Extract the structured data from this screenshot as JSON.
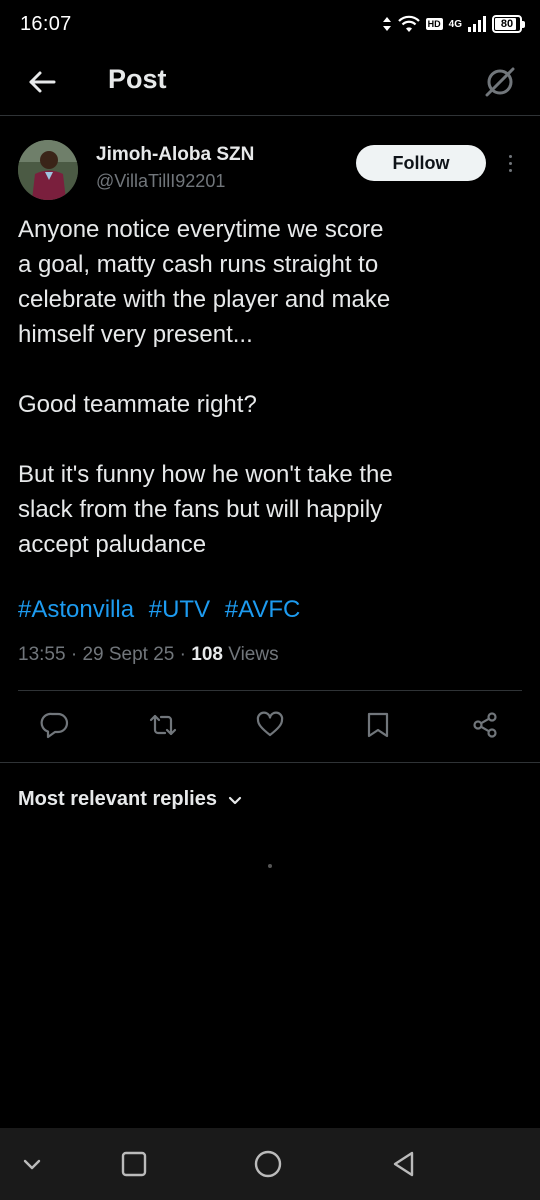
{
  "status_bar": {
    "time": "16:07",
    "network_badge": "HD",
    "network_type": "4G",
    "battery": "80",
    "battery_level": 0.8
  },
  "header": {
    "title": "Post",
    "back_icon": "arrow-left-icon",
    "grok_icon": "grok-icon"
  },
  "post": {
    "author_name": "Jimoh-Aloba SZN",
    "author_handle": "@VillaTillI92201",
    "follow_label": "Follow",
    "body_lines": [
      "Anyone notice everytime we score",
      "a goal, matty cash runs straight to",
      "celebrate with the player and make",
      "himself very present...",
      "",
      "Good teammate right?",
      "",
      "But it's funny how he won't take the",
      "slack from the fans but will happily",
      "accept paludance"
    ],
    "hashtags": [
      "#Astonvilla",
      "#UTV",
      "#AVFC"
    ],
    "time": "13:55",
    "date": "29 Sept 25",
    "views_count": "108",
    "views_label": "Views",
    "separator": "·"
  },
  "actions": [
    "reply-icon",
    "repost-icon",
    "like-icon",
    "bookmark-icon",
    "share-icon"
  ],
  "replies": {
    "sort_label": "Most relevant replies"
  },
  "nav": [
    "chevron-down-icon",
    "recent-apps-icon",
    "home-icon",
    "back-icon"
  ],
  "colors": {
    "background": "#000000",
    "text": "#e7e9ea",
    "muted": "#71767b",
    "link": "#1d9bf0",
    "divider": "#2f3336"
  }
}
